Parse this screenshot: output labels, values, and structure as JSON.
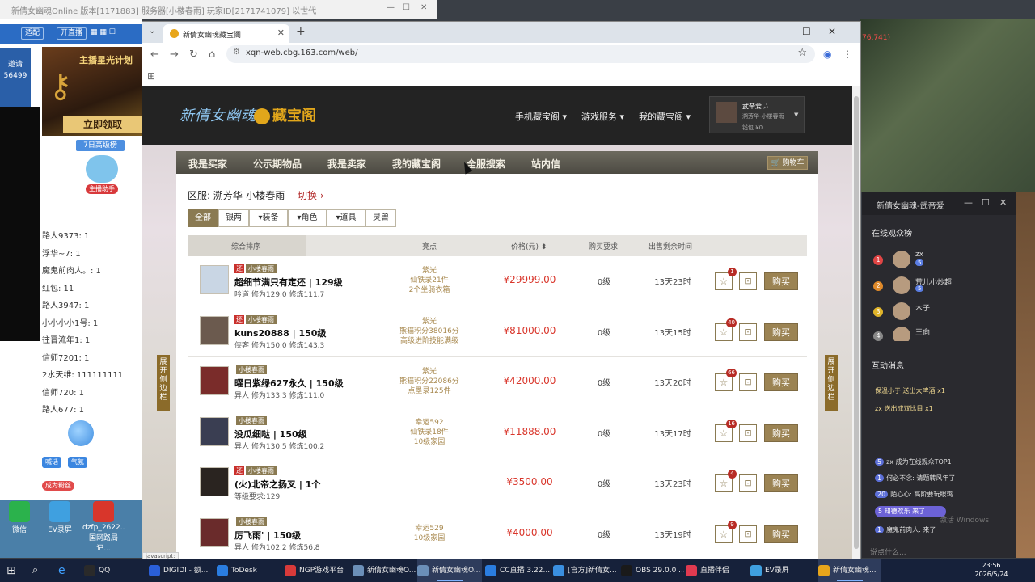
{
  "background": {
    "top_title": "新倩女幽魂Online 版本[1171883] 服务器[小楼春雨] 玩家ID[2171741079] 以世代",
    "stream_toolbar": {
      "btn_a": "适配",
      "btn_b": "开直播"
    },
    "left_blue": {
      "line1": "邀请",
      "line2": "56499"
    },
    "promo": {
      "headline": "主播星光计划",
      "cta": "立即领取"
    },
    "seven_day": "7日高级榜",
    "mascot_tag": "主播助手",
    "chat_lines": [
      "路人9373: 1",
      "浮华~7: 1",
      "魔鬼前肉人。: 1",
      "红包: 11",
      "路人3947: 1",
      "小小小小1号: 1",
      "往晋流年1: 1",
      "信师7201: 1",
      "2水天维: 111111111",
      "信师720: 1",
      "路人677: 1"
    ],
    "strip_buttons": [
      "喊话",
      "气氛"
    ],
    "red_tag": "成为粉丝",
    "desktop_icons": [
      {
        "label": "微信",
        "color": "#2bb24c"
      },
      {
        "label": "EV录屏",
        "color": "#3fa0e0"
      },
      {
        "label": "dzfp_2622... 国网路局记...",
        "color": "#d8362b"
      }
    ],
    "game_num": "76,741)"
  },
  "live_panel": {
    "title": "新倩女幽魂-武帝爱",
    "viewers_title": "在线观众榜",
    "viewers": [
      {
        "rank": "1",
        "name": "zx",
        "badge": "5",
        "color": "#e04545"
      },
      {
        "rank": "2",
        "name": "荒儿小炒超",
        "badge": "5",
        "color": "#e08a2a"
      },
      {
        "rank": "3",
        "name": "木子",
        "badge": "",
        "color": "#e0b42a"
      },
      {
        "rank": "4",
        "name": "王向",
        "badge": "",
        "color": "#888888"
      }
    ],
    "interact_title": "互动消息",
    "gifts": [
      {
        "text": "保温小于  送出大啤酒  x1"
      },
      {
        "text": "zx  送出成双比目  x1"
      }
    ],
    "messages": [
      {
        "pill": "5",
        "text": "zx 成为在线观众TOP1"
      },
      {
        "pill": "1",
        "text": "何必不念: 请题转风年了"
      },
      {
        "pill": "20",
        "text": "陌心心: 高阶要玩眼鸡"
      },
      {
        "pill": "1",
        "text": "魔鬼前肉人: 来了"
      }
    ],
    "highlight_msg": "5  知德欢乐 来了",
    "windows_watermark": "激活 Windows",
    "input_placeholder": "说点什么..."
  },
  "browser": {
    "tab_title": "新倩女幽魂藏宝阁",
    "url": "xqn-web.cbg.163.com/web/",
    "status_text": "javascript:"
  },
  "site": {
    "logo_game": "新倩女幽魂",
    "logo_cbg": "藏宝阁",
    "header_nav": [
      "手机藏宝阁",
      "游戏服务",
      "我的藏宝阁"
    ],
    "user": {
      "name": "武帝爱い",
      "server": "溯芳华-小楼春雨",
      "wallet": "钱包 ¥0"
    },
    "main_nav": [
      "我是买家",
      "公示期物品",
      "我是卖家",
      "我的藏宝阁",
      "全服搜索",
      "站内信"
    ],
    "cart_label": "购物车",
    "server_label": "区服: 溯芳华-小楼春雨",
    "switch_label": "切换",
    "categories": [
      "全部",
      "银两",
      "装备",
      "角色",
      "道具",
      "灵兽"
    ],
    "columns": {
      "sort": "综合排序",
      "highlight": "亮点",
      "price": "价格(元)",
      "req": "购买要求",
      "time": "出售剩余时间"
    },
    "buy_label": "购买",
    "side_tab": "展开侧边栏",
    "items": [
      {
        "tag_r": "还",
        "tag_g": "小楼春雨",
        "name": "超细节满只有定还 | 129级",
        "sub": "吟道 修为129.0 修炼111.7",
        "hl": [
          "紫光",
          "仙铁录21件",
          "2个坐骑衣箱"
        ],
        "price": "¥29999.00",
        "req": "0级",
        "time": "13天23时",
        "fav": "1",
        "avatar": "#c9d6e4"
      },
      {
        "tag_r": "还",
        "tag_g": "小楼春雨",
        "name": "kuns20888 | 150级",
        "sub": "侠客 修为150.0 修炼143.3",
        "hl": [
          "紫光",
          "熊猫积分38016分",
          "高级进阶技能满级"
        ],
        "price": "¥81000.00",
        "req": "0级",
        "time": "13天15时",
        "fav": "40",
        "avatar": "#6b5a4e"
      },
      {
        "tag_r": "",
        "tag_g": "小楼春雨",
        "name": "曜日紫绿627永久 | 150级",
        "sub": "异人 修为133.3 修炼111.0",
        "hl": [
          "紫光",
          "熊猫积分22086分",
          "点墨录125件"
        ],
        "price": "¥42000.00",
        "req": "0级",
        "time": "13天20时",
        "fav": "66",
        "avatar": "#7a2c2a"
      },
      {
        "tag_r": "",
        "tag_g": "小楼春雨",
        "name": "没瓜细哒 | 150级",
        "sub": "异人 修为130.5 修炼100.2",
        "hl": [
          "幸运592",
          "仙铁录18件",
          "10级家园"
        ],
        "price": "¥11888.00",
        "req": "0级",
        "time": "13天17时",
        "fav": "16",
        "avatar": "#3a3e52"
      },
      {
        "tag_r": "还",
        "tag_g": "小楼春雨",
        "name": "(火)北帝之扬叉 | 1个",
        "sub": "等级要求:129",
        "hl": [],
        "price": "¥3500.00",
        "req": "0级",
        "time": "13天23时",
        "fav": "4",
        "avatar": "#2a2420"
      },
      {
        "tag_r": "",
        "tag_g": "小楼春雨",
        "name": "厉飞雨' | 150级",
        "sub": "异人 修为102.2 修炼56.8",
        "hl": [
          "幸运529",
          "10级家园"
        ],
        "price": "¥4000.00",
        "req": "0级",
        "time": "13天19时",
        "fav": "9",
        "avatar": "#6a2b2b"
      }
    ]
  },
  "taskbar": {
    "items": [
      {
        "label": "QQ",
        "color": "#2a2a2a"
      },
      {
        "label": "DIGIDI - 额...",
        "color": "#2a5fd8"
      },
      {
        "label": "ToDesk",
        "color": "#2a7de0"
      },
      {
        "label": "NGP游戏平台",
        "color": "#d83a3a"
      },
      {
        "label": "新倩女幽魂O...",
        "color": "#6b8fb8"
      },
      {
        "label": "新倩女幽魂O...",
        "color": "#6b8fb8"
      },
      {
        "label": "CC直播 3.22....",
        "color": "#2a7de0"
      },
      {
        "label": "[官方]新倩女...",
        "color": "#3a8fe0"
      },
      {
        "label": "OBS 29.0.0 ...",
        "color": "#1a1a1a"
      },
      {
        "label": "直播伴侣",
        "color": "#e03a50"
      },
      {
        "label": "EV录屏",
        "color": "#3fa0e0"
      },
      {
        "label": "新倩女幽魂...",
        "color": "#e8a61b"
      }
    ],
    "clock_time": "23:56",
    "clock_date": "2026/5/24"
  }
}
